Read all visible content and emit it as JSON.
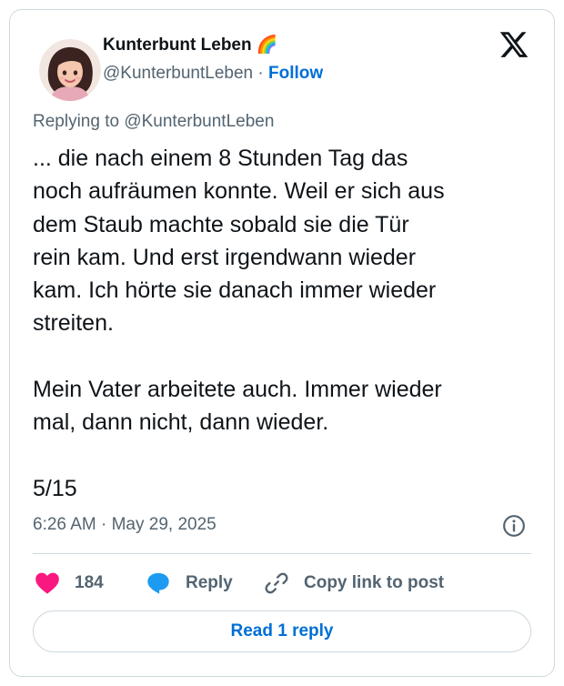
{
  "author": {
    "name": "Kunterbunt Leben 🌈",
    "handle": "@KunterbuntLeben",
    "separator": "·",
    "follow_label": "Follow"
  },
  "replying_to": "Replying to @KunterbuntLeben",
  "tweet_text": "... die nach einem 8 Stunden Tag das\nnoch aufräumen konnte. Weil er sich aus\ndem Staub machte sobald sie die Tür\nrein kam. Und erst irgendwann wieder\nkam. Ich hörte sie danach immer wieder\nstreiten.\n\nMein Vater arbeitete auch. Immer wieder\nmal, dann nicht, dann wieder.\n\n5/15",
  "timestamp": "6:26 AM · May 29, 2025",
  "actions": {
    "likes_count": "184",
    "reply_label": "Reply",
    "copy_label": "Copy link to post"
  },
  "read_replies_label": "Read 1 reply",
  "icons": {
    "like": "heart-icon",
    "reply": "speech-bubble-icon",
    "copy": "link-icon",
    "info": "info-icon",
    "brand": "x-logo-icon"
  },
  "colors": {
    "like": "#f91880",
    "reply": "#1d9bf0",
    "link": "#006fd6",
    "secondary_text": "#536471",
    "border": "#cfd9de"
  }
}
